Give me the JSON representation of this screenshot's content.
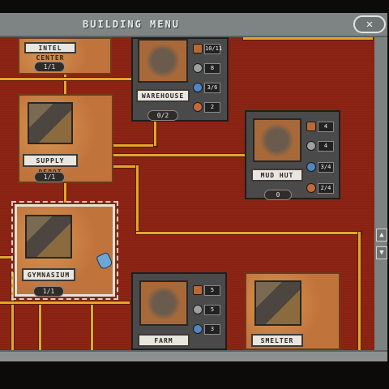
{
  "window": {
    "title": "BUILDING MENU",
    "close_label": "✕"
  },
  "scroll": {
    "up_label": "▲",
    "down_label": "▼"
  },
  "buildings_left": [
    {
      "name": "INTEL CENTER",
      "count": "1/1"
    },
    {
      "name": "SUPPLY DEPOT",
      "count": "1/1"
    },
    {
      "name": "GYMNASIUM",
      "count": "1/1"
    }
  ],
  "warehouse": {
    "name": "WAREHOUSE",
    "count": "0/2",
    "costs": [
      "10/11",
      "8",
      "3/6",
      "2"
    ]
  },
  "mud_hut": {
    "name": "MUD HUT",
    "count": "0",
    "costs": [
      "4",
      "4",
      "3/4",
      "2/4"
    ]
  },
  "farm": {
    "name": "FARM",
    "costs": [
      "5",
      "5",
      "3"
    ]
  },
  "smelter": {
    "name": "SMELTER"
  },
  "colors": {
    "map_bg": "#8c2414",
    "path": "#e0a62c",
    "frame": "#8a8f8f"
  }
}
